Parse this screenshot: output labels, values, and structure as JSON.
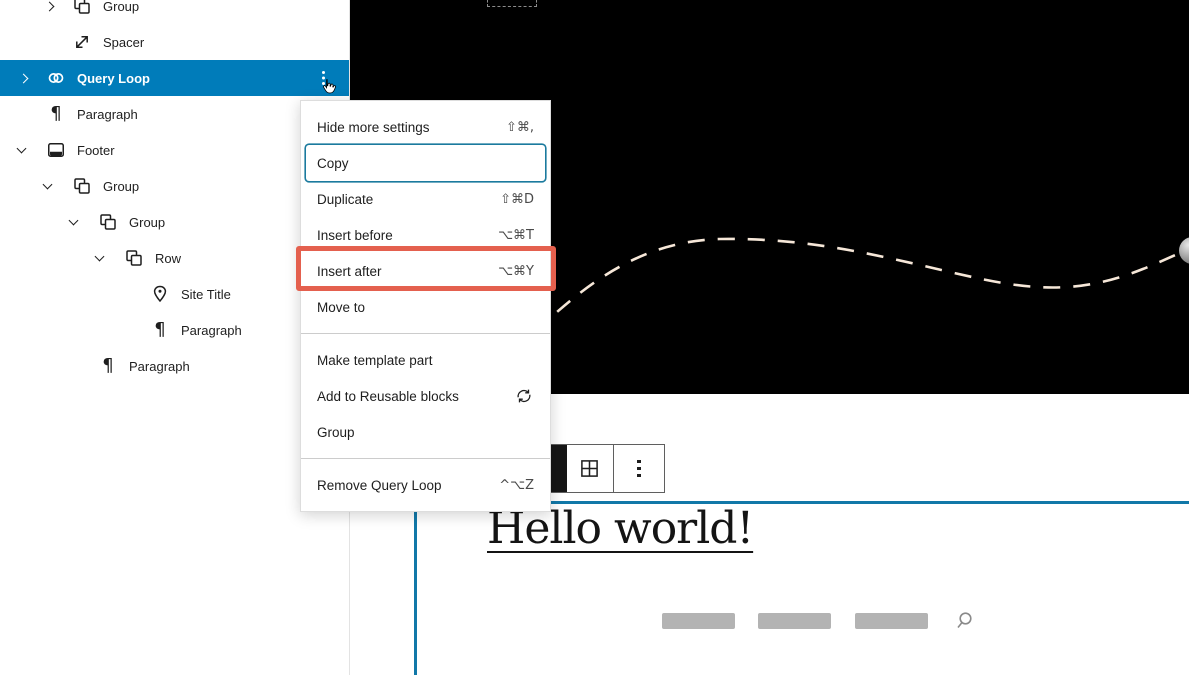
{
  "app": "WordPress site editor — List View with block options menu open",
  "sidebar": {
    "items": [
      {
        "label": "Group"
      },
      {
        "label": "Spacer"
      },
      {
        "label": "Query Loop",
        "selected": true
      },
      {
        "label": "Paragraph"
      },
      {
        "label": "Footer"
      },
      {
        "label": "Group"
      },
      {
        "label": "Group"
      },
      {
        "label": "Row"
      },
      {
        "label": "Site Title"
      },
      {
        "label": "Paragraph"
      },
      {
        "label": "Paragraph"
      }
    ]
  },
  "context_menu": {
    "groups": [
      {
        "items": [
          {
            "label": "Hide more settings",
            "shortcut": "⇧⌘,"
          },
          {
            "label": "Copy",
            "focused": true
          },
          {
            "label": "Duplicate",
            "shortcut": "⇧⌘D"
          },
          {
            "label": "Insert before",
            "shortcut": "⌥⌘T"
          },
          {
            "label": "Insert after",
            "shortcut": "⌥⌘Y",
            "highlighted": true
          },
          {
            "label": "Move to"
          }
        ]
      },
      {
        "items": [
          {
            "label": "Make template part"
          },
          {
            "label": "Add to Reusable blocks",
            "trailing_icon": "reusable-block-icon"
          },
          {
            "label": "Group"
          }
        ]
      },
      {
        "items": [
          {
            "label": "Remove Query Loop",
            "shortcut": "^⌥Z"
          }
        ]
      }
    ]
  },
  "canvas": {
    "post_title": "Hello world!",
    "nav_placeholder_count": 3
  },
  "icons": {
    "paragraph_glyph": "¶"
  },
  "colors": {
    "accent": "#007cba",
    "selected_row": "#007cba",
    "annotation_highlight": "#e4604e",
    "curve": "#f6e7d8",
    "header_background": "#000000",
    "placeholder_gray": "#b3b3b3"
  }
}
